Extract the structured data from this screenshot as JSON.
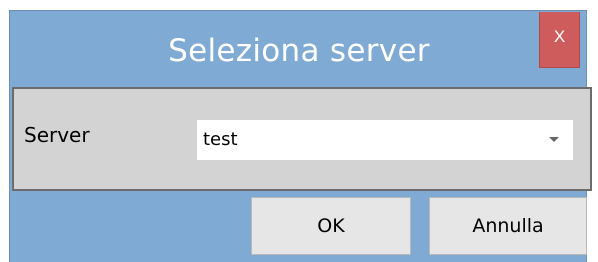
{
  "dialog": {
    "title": "Seleziona server",
    "close_label": "X",
    "accent_color": "#7eaad3",
    "close_color": "#cf5c5c"
  },
  "form": {
    "server_label": "Server",
    "server_value": "test"
  },
  "buttons": {
    "ok_label": "OK",
    "cancel_label": "Annulla"
  }
}
